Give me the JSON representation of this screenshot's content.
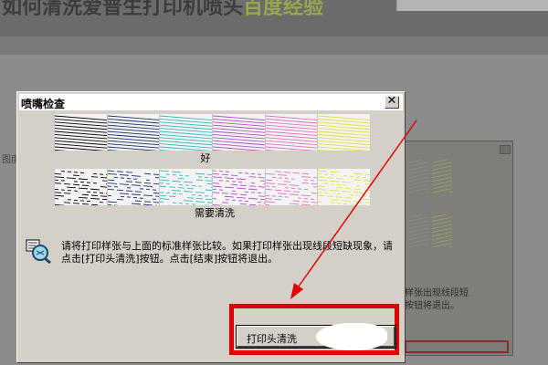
{
  "background": {
    "title_main": "如何清洗爱普生打印机喷头",
    "title_highlight": "百度经验",
    "left_fragment": "图度",
    "second_window_text": "样张出现线段短\n按钮将退出。"
  },
  "dialog": {
    "title": "喷嘴检查",
    "close_glyph": "✕",
    "good_label": "好",
    "bad_label": "需要清洗",
    "instructions": "请将打印样张与上面的标准样张比较。如果打印样张出现线段短缺现象，请点击[打印头清洗]按钮。点击[结束]按钮将退出。",
    "clean_button_label": "打印头清洗",
    "pattern_colors": [
      "#000000",
      "#1a2e6e",
      "#34b8b8",
      "#b050c8",
      "#e070c0",
      "#e0e040"
    ]
  },
  "annotations": {
    "highlight_color": "#e00000",
    "arrow_color": "#e00000"
  }
}
